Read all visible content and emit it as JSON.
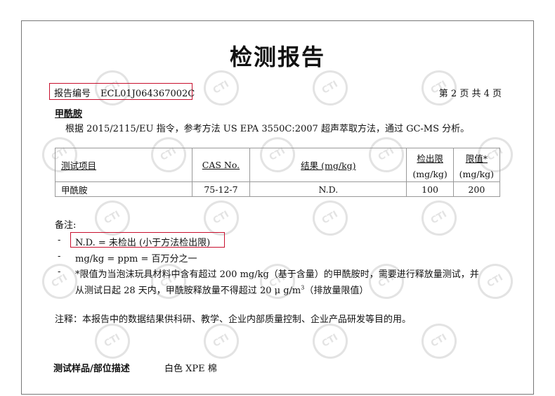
{
  "watermark": {
    "text": "CTI"
  },
  "title": "检测报告",
  "report_number": {
    "label": "报告编号",
    "value": "ECL01J064367002C"
  },
  "page_info": "第 2 页   共 4 页",
  "analyte_heading": "甲酰胺",
  "method_text": "根据 2015/2115/EU 指令，参考方法 US EPA 3550C:2007  超声萃取方法，通过 GC-MS  分析。",
  "table": {
    "headers": {
      "item": "测试项目",
      "cas": "CAS No.",
      "result": "结果  (mg/kg)",
      "mdl": "检出限",
      "mdl_unit": "(mg/kg)",
      "limit": "限值*",
      "limit_unit": "(mg/kg)"
    },
    "rows": [
      {
        "item": "甲酰胺",
        "cas": "75-12-7",
        "result": "N.D.",
        "mdl": "100",
        "limit": "200"
      }
    ]
  },
  "notes": {
    "title": "备注:",
    "dash": "-",
    "nd": "N.D. =  未检出  (小于方法检出限)",
    "ppm": "mg/kg = ppm =  百万分之一",
    "limit_line1": "*限值为当泡沫玩具材料中含有超过 200  mg/kg（基于含量）的甲酰胺时，需要进行释放量测试，并",
    "limit_line2_a": "从测试日起 28 天内，甲酰胺释放量不得超过 20  μ g/m",
    "limit_line2_sup": "3",
    "limit_line2_b": "（排放量限值）"
  },
  "remark": "注释：本报告中的数据结果供科研、教学、企业内部质量控制、企业产品研发等目的用。",
  "sample": {
    "label": "测试样品/部位描述",
    "value": "白色 XPE 棉"
  },
  "colors": {
    "highlight_box": "#c8102e",
    "watermark": "#e3e3e3"
  }
}
